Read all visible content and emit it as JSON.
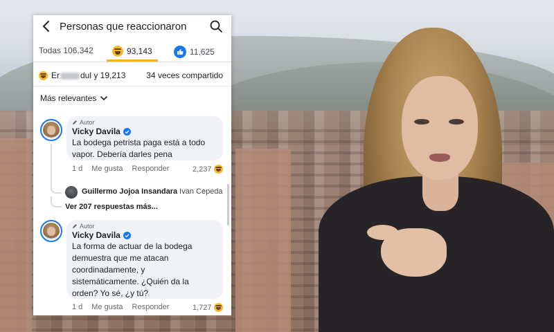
{
  "header": {
    "title": "Personas que reaccionaron"
  },
  "tabs": [
    {
      "label": "Todas 106,342",
      "icon": "none"
    },
    {
      "label": "93,143",
      "icon": "haha-emoji"
    },
    {
      "label": "11,625",
      "icon": "like-icon"
    }
  ],
  "summary": {
    "name_start": "Er",
    "name_end": "dul y 19,213",
    "shares": "34 veces compartido"
  },
  "sort": {
    "label": "Más relevantes"
  },
  "comments": [
    {
      "badge": "Autor",
      "author": "Vicky Davila",
      "text_lines": [
        "La bodega petrista paga está a todo",
        "vapor. Debería darles pena"
      ],
      "time": "1 d",
      "like": "Me gusta",
      "reply": "Responder",
      "reaction_count": "2,237"
    },
    {
      "badge": "Autor",
      "author": "Vicky Davila",
      "text_lines": [
        "La forma de actuar de la bodega",
        "demuestra que me atacan",
        "coordinadamente, y",
        "sistemáticamente. ¿Quién da la",
        "orden? Yo sé, ¿y tú?"
      ],
      "time": "1 d",
      "like": "Me gusta",
      "reply": "Responder",
      "reaction_count": "1,727"
    }
  ],
  "reply_preview": {
    "author": "Guillermo Jojoa Insandara",
    "snippet": "Ivan Cepeda",
    "more": "Ver 207 respuestas más..."
  },
  "colors": {
    "facebook_blue": "#1877f2",
    "haha_yellow": "#f7b928",
    "bubble_grey": "#f0f2f5"
  }
}
